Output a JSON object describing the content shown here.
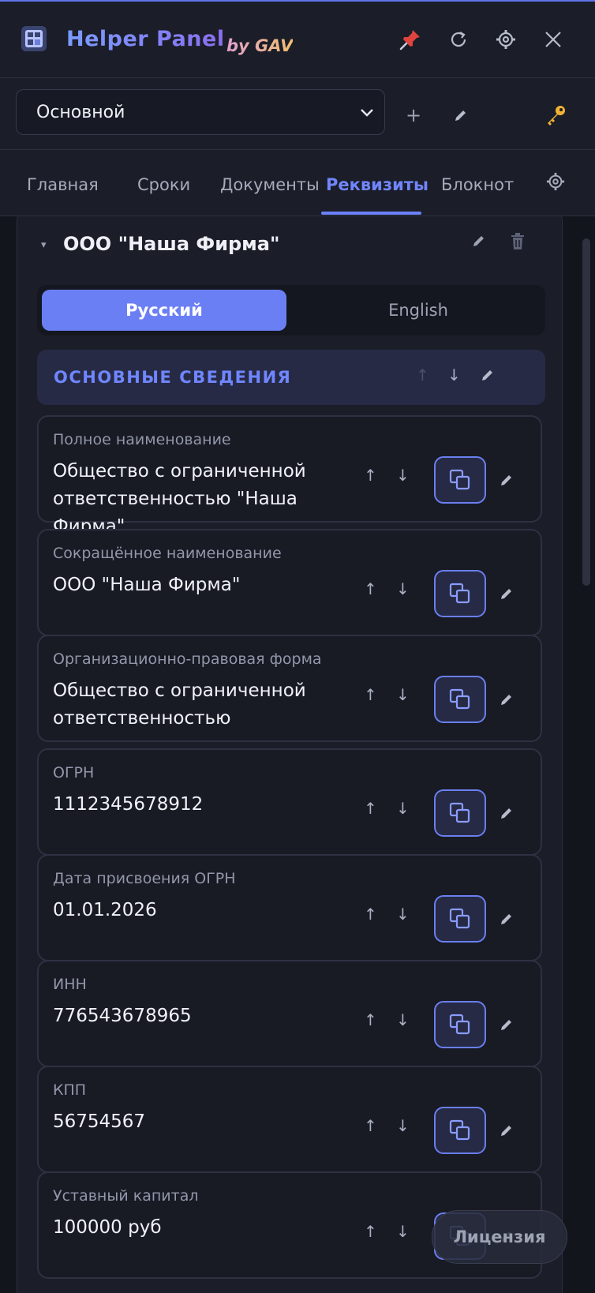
{
  "header": {
    "title": "Helper Panel",
    "subtitle": "by GAV",
    "buttons": [
      "pin-icon",
      "refresh-icon",
      "gear-icon",
      "close-icon"
    ]
  },
  "profile": {
    "selected": "Основной",
    "add_label": "+"
  },
  "tabs": [
    {
      "label": "Главная",
      "active": false
    },
    {
      "label": "Сроки",
      "active": false
    },
    {
      "label": "Документы",
      "active": false
    },
    {
      "label": "Реквизиты",
      "active": true
    },
    {
      "label": "Блокнот",
      "active": false
    }
  ],
  "company": {
    "caret": "▾",
    "name": "ООО \"Наша Фирма\""
  },
  "language": {
    "options": [
      "Русский",
      "English"
    ],
    "selected": "Русский"
  },
  "section": {
    "title": "ОСНОВНЫЕ СВЕДЕНИЯ"
  },
  "arrows": {
    "up": "↑",
    "down": "↓"
  },
  "fields": [
    {
      "label": "Полное наименование",
      "value": "Общество с ограниченной ответственностью \"Наша Фирма\""
    },
    {
      "label": "Сокращённое наименование",
      "value": "ООО \"Наша Фирма\""
    },
    {
      "label": "Организационно-правовая форма",
      "value": "Общество с ограниченной ответственностью"
    },
    {
      "label": "ОГРН",
      "value": "1112345678912"
    },
    {
      "label": "Дата присвоения ОГРН",
      "value": "01.01.2026"
    },
    {
      "label": "ИНН",
      "value": "776543678965"
    },
    {
      "label": "КПП",
      "value": "56754567"
    },
    {
      "label": "Уставный капитал",
      "value": "100000 руб"
    }
  ],
  "license_label": "Лицензия",
  "colors": {
    "accent": "#6b7ff4",
    "background": "#13151d",
    "panel": "#1b1d28"
  }
}
